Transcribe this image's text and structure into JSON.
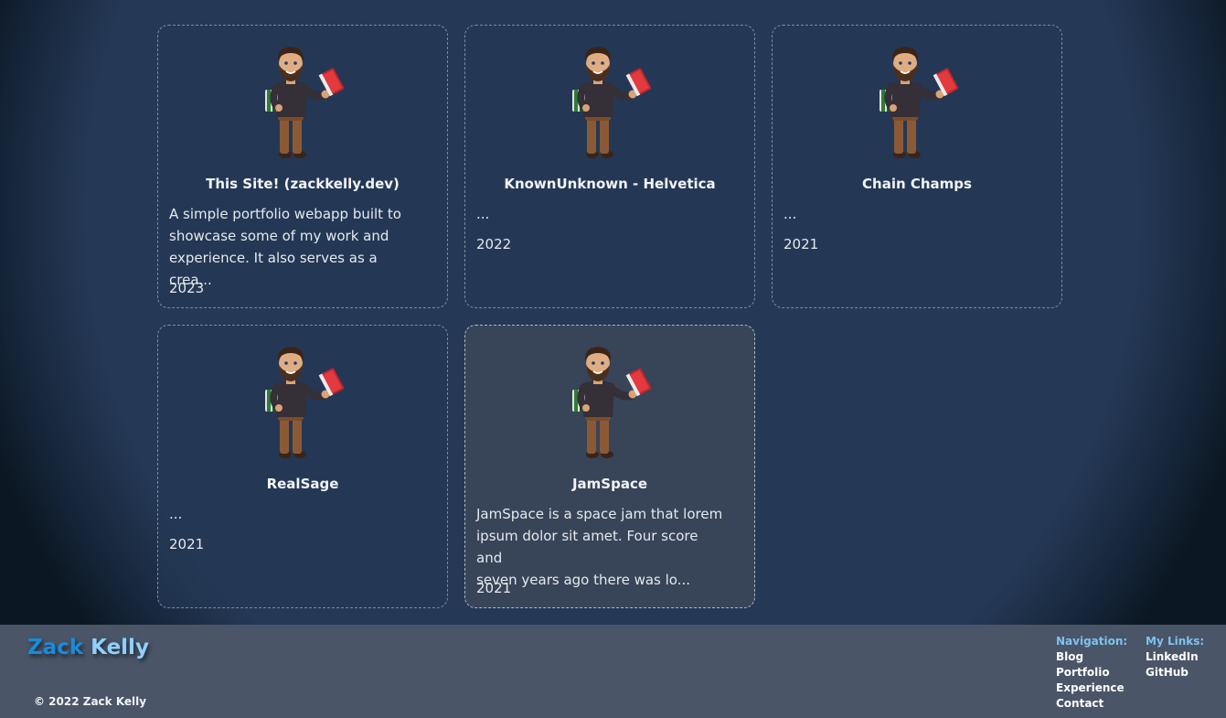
{
  "projects": [
    {
      "title": "This Site! (zackkelly.dev)",
      "description": "A simple portfolio webapp built to\nshowcase some of my work and\nexperience. It also serves as a crea...",
      "year": "2023"
    },
    {
      "title": "KnownUnknown - Helvetica",
      "description": "...",
      "year": "2022"
    },
    {
      "title": "Chain Champs",
      "description": "...",
      "year": "2021"
    },
    {
      "title": "RealSage",
      "description": "...",
      "year": "2021"
    },
    {
      "title": "JamSpace",
      "description": "JamSpace is a space jam that lorem\nipsum dolor sit amet. Four score and\nseven years ago there was lo...",
      "year": "2021"
    }
  ],
  "footer": {
    "brand_first": "Zack",
    "brand_last": "Kelly",
    "copyright": "© 2022 Zack Kelly",
    "navigation": {
      "heading": "Navigation:",
      "links": [
        "Blog",
        "Portfolio",
        "Experience",
        "Contact"
      ]
    },
    "my_links": {
      "heading": "My Links:",
      "links": [
        "LinkedIn",
        "GitHub"
      ]
    }
  },
  "colors": {
    "background": "#253856",
    "footer": "#4a5567",
    "brand_first": "#1a8bdc",
    "brand_last": "#8ed0ff",
    "footer_heading": "#7cc3f0"
  },
  "icons": {
    "avatar": "bitmoji-avatar-with-books-icon"
  }
}
